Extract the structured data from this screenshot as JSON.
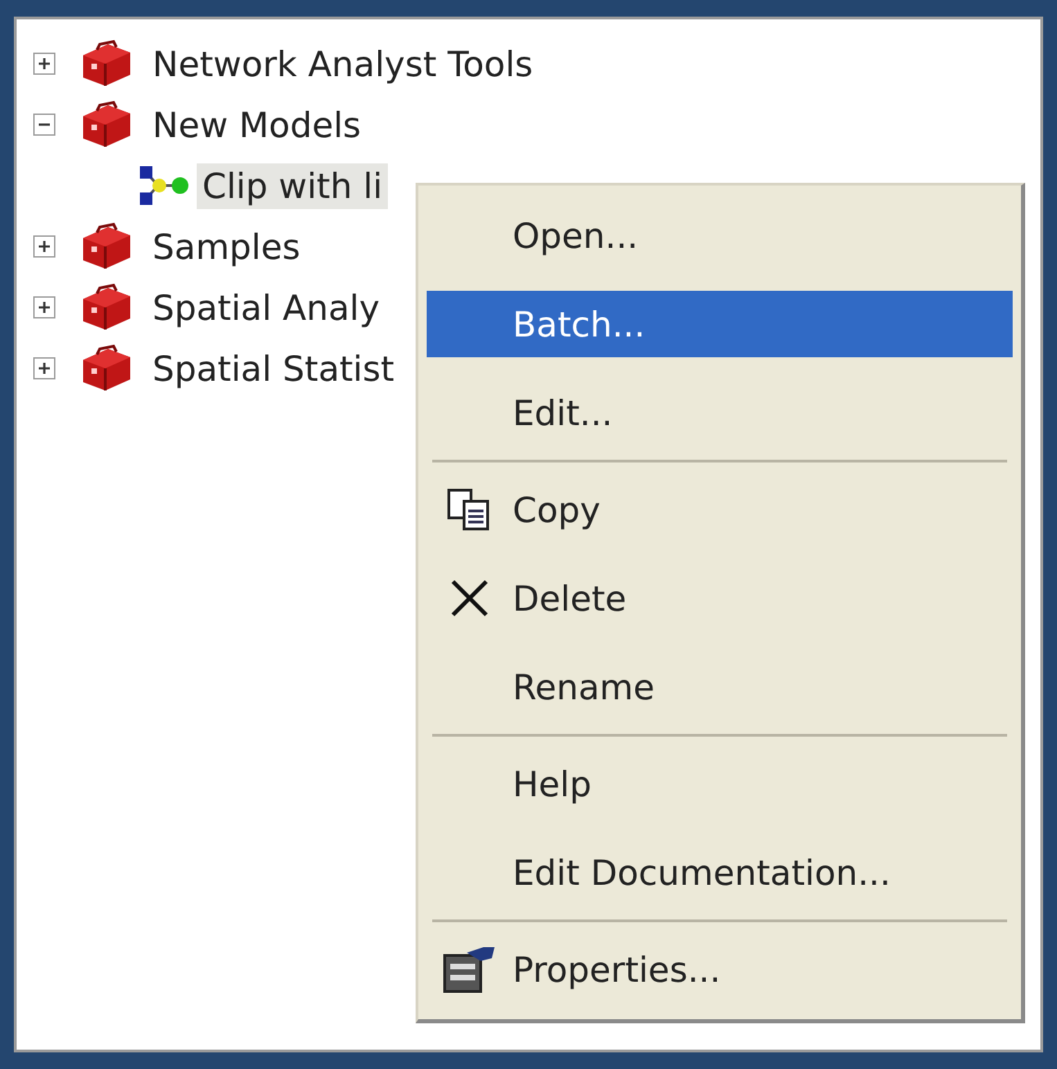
{
  "tree": [
    {
      "kind": "toolbox",
      "label": "Network Analyst Tools",
      "expanded": false,
      "selected": false
    },
    {
      "kind": "toolbox",
      "label": "New Models",
      "expanded": true,
      "selected": false,
      "children": [
        {
          "kind": "model",
          "label": "Clip with li",
          "selected": true
        }
      ]
    },
    {
      "kind": "toolbox",
      "label": "Samples",
      "expanded": false,
      "selected": false
    },
    {
      "kind": "toolbox",
      "label": "Spatial Analy",
      "expanded": false,
      "selected": false
    },
    {
      "kind": "toolbox",
      "label": "Spatial Statist",
      "expanded": false,
      "selected": false
    }
  ],
  "context_menu": [
    {
      "kind": "plain",
      "label": "Open...",
      "selected": false
    },
    {
      "kind": "plain",
      "label": "Batch...",
      "selected": true
    },
    {
      "kind": "plain",
      "label": "Edit...",
      "selected": false
    },
    {
      "kind": "separator"
    },
    {
      "kind": "copy",
      "label": "Copy",
      "selected": false
    },
    {
      "kind": "delete",
      "label": "Delete",
      "selected": false
    },
    {
      "kind": "plain",
      "label": "Rename",
      "selected": false
    },
    {
      "kind": "separator"
    },
    {
      "kind": "plain",
      "label": "Help",
      "selected": false
    },
    {
      "kind": "plain",
      "label": "Edit Documentation...",
      "selected": false
    },
    {
      "kind": "separator"
    },
    {
      "kind": "properties",
      "label": "Properties...",
      "selected": false
    }
  ]
}
